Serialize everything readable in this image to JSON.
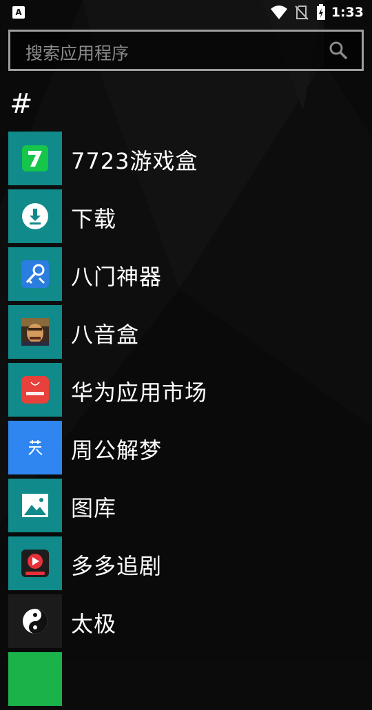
{
  "status_bar": {
    "notification_icon": "a-icon",
    "time": "1:33",
    "icons": [
      "wifi-icon",
      "sim-off-icon",
      "battery-charging-icon"
    ]
  },
  "search": {
    "placeholder": "搜索应用程序",
    "icon": "search-icon"
  },
  "section": {
    "header": "#"
  },
  "apps": [
    {
      "label": "7723游戏盒",
      "icon": "game-box-icon",
      "tile_color": "#108a8a"
    },
    {
      "label": "下载",
      "icon": "download-icon",
      "tile_color": "#108a8a"
    },
    {
      "label": "八门神器",
      "icon": "key-search-icon",
      "tile_color": "#108a8a"
    },
    {
      "label": "八音盒",
      "icon": "portrait-icon",
      "tile_color": "#108a8a"
    },
    {
      "label": "华为应用市场",
      "icon": "shopping-bag-icon",
      "tile_color": "#108a8a"
    },
    {
      "label": "周公解梦",
      "icon": "dream-icon",
      "tile_color": "#2f86f0"
    },
    {
      "label": "图库",
      "icon": "gallery-icon",
      "tile_color": "#108a8a"
    },
    {
      "label": "多多追剧",
      "icon": "play-icon",
      "tile_color": "#108a8a"
    },
    {
      "label": "太极",
      "icon": "yin-yang-icon",
      "tile_color": "#1b1b1b"
    },
    {
      "label": "",
      "icon": "",
      "tile_color": "#19b34a"
    }
  ],
  "colors": {
    "tile_default": "#108a8a",
    "search_border": "#9e9e9e",
    "placeholder_text": "#8a8a8a"
  }
}
